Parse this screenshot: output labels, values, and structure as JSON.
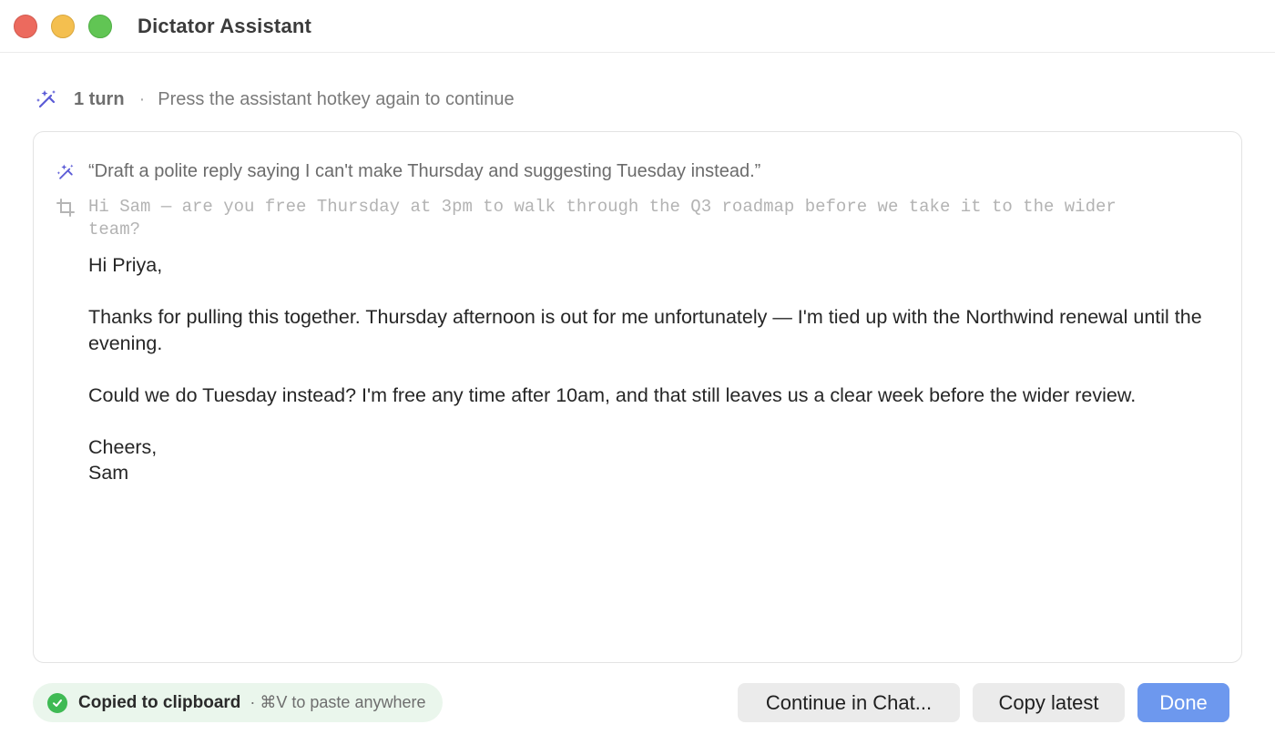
{
  "window": {
    "title": "Dictator Assistant"
  },
  "status": {
    "turns": "1 turn",
    "separator": "·",
    "hint": "Press the assistant hotkey again to continue",
    "icon": "magic-wand-icon"
  },
  "conversation": {
    "prompt": "“Draft a polite reply saying I can't make Thursday and suggesting Tuesday instead.”",
    "prompt_icon": "magic-wand-icon",
    "context_icon": "crop-icon",
    "context": "Hi Sam — are you free Thursday at 3pm to walk through the Q3 roadmap before we take it to the wider team?",
    "reply": {
      "greeting": "Hi Priya,",
      "paragraph1": "Thanks for pulling this together. Thursday afternoon is out for me unfortunately — I'm tied up with the Northwind renewal until the evening.",
      "paragraph2": "Could we do Tuesday instead? I'm free any time after 10am, and that still leaves us a clear week before the wider review.",
      "signoff": "Cheers,",
      "name": "Sam"
    }
  },
  "footer": {
    "copied_label": "Copied to clipboard",
    "copied_hint": "· ⌘V to paste anywhere",
    "continue_label": "Continue in Chat...",
    "copy_label": "Copy latest",
    "done_label": "Done"
  },
  "colors": {
    "accent": "#6d98ee",
    "success": "#3fba54",
    "wand": "#5b5bd6"
  }
}
